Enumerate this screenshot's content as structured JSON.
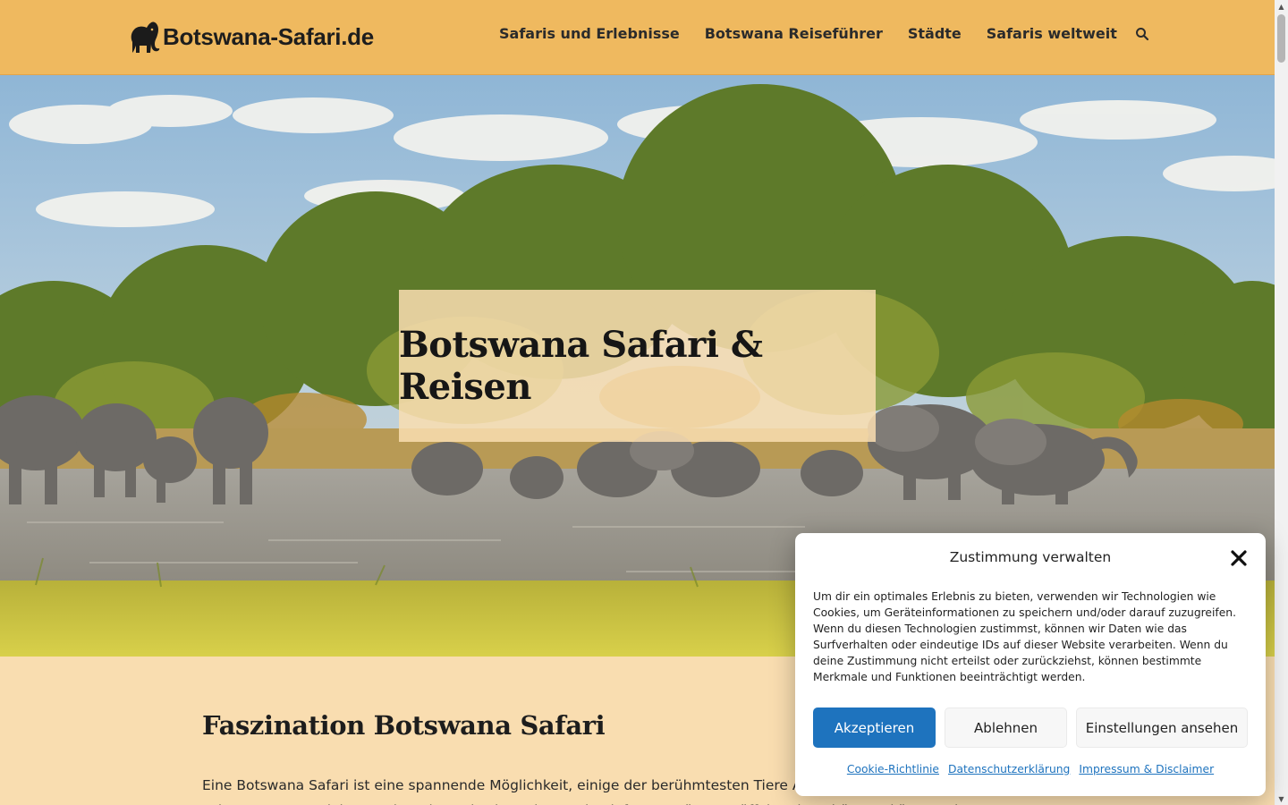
{
  "header": {
    "logo_text": "Botswana-Safari.de",
    "nav": [
      {
        "label": "Safaris und Erlebnisse"
      },
      {
        "label": "Botswana Reiseführer"
      },
      {
        "label": "Städte"
      },
      {
        "label": "Safaris weltweit"
      }
    ],
    "search_icon": "search-icon",
    "background_color": "#efb95f"
  },
  "hero": {
    "title": "Botswana Safari & Reisen",
    "image_subject": "elephant herd at waterhole"
  },
  "content": {
    "heading": "Faszination Botswana Safari",
    "paragraph": "Eine Botswana Safari ist eine spannende Möglichkeit, einige der berühmtesten Tiere Afrikas in ihrem natürlichen Lebensraum zu erleben. Neben den „Big Five“-Tieren wie Elefanten, Löwen, Büffel und Nashörnern können Sie"
  },
  "cookie_dialog": {
    "title": "Zustimmung verwalten",
    "close_icon": "close-icon",
    "text": "Um dir ein optimales Erlebnis zu bieten, verwenden wir Technologien wie Cookies, um Geräteinformationen zu speichern und/oder darauf zuzugreifen. Wenn du diesen Technologien zustimmst, können wir Daten wie das Surfverhalten oder eindeutige IDs auf dieser Website verarbeiten. Wenn du deine Zustimmung nicht erteilst oder zurückziehst, können bestimmte Merkmale und Funktionen beeinträchtigt werden.",
    "accept_label": "Akzeptieren",
    "deny_label": "Ablehnen",
    "settings_label": "Einstellungen ansehen",
    "links": [
      {
        "label": "Cookie-Richtlinie"
      },
      {
        "label": "Datenschutzerklärung"
      },
      {
        "label": "Impressum & Disclaimer"
      }
    ],
    "accent_color": "#1e73be"
  }
}
